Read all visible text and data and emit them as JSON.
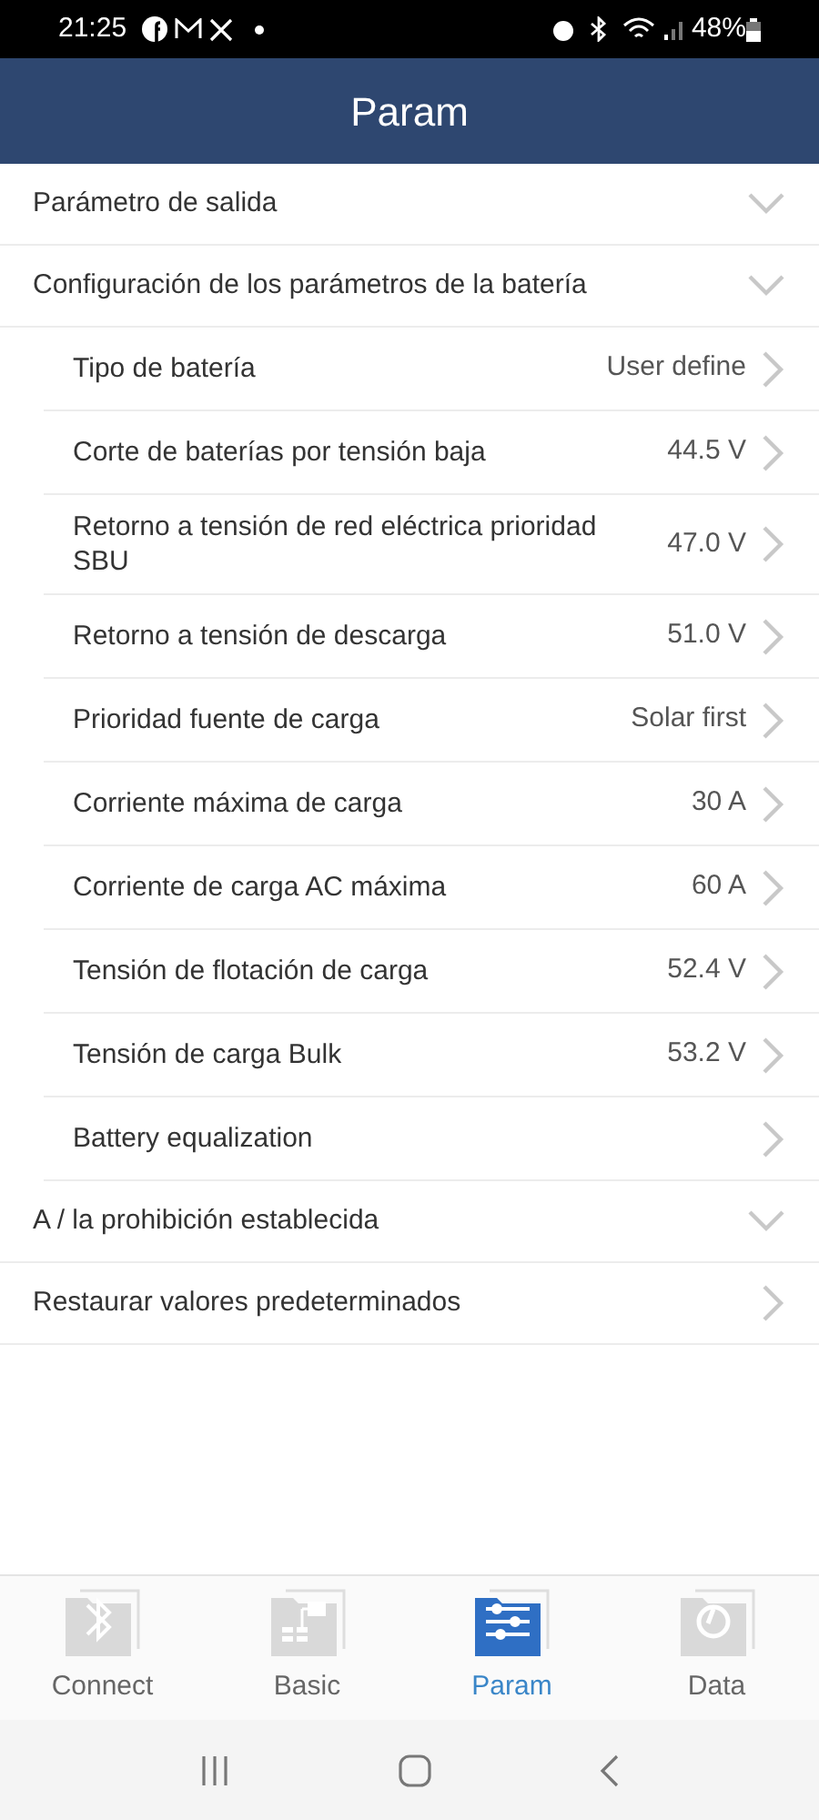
{
  "status_bar": {
    "time": "21:25",
    "battery": "48%"
  },
  "header": {
    "title": "Param"
  },
  "sections": [
    {
      "kind": "group",
      "label": "Parámetro de salida"
    },
    {
      "kind": "group",
      "label": "Configuración de los parámetros de la batería",
      "items": [
        {
          "label": "Tipo de batería",
          "value": "User define"
        },
        {
          "label": "Corte de baterías por tensión baja",
          "value": "44.5 V"
        },
        {
          "label": "Retorno a tensión de red eléctrica prioridad SBU",
          "value": "47.0 V"
        },
        {
          "label": "Retorno a tensión de descarga",
          "value": "51.0 V"
        },
        {
          "label": "Prioridad fuente de carga",
          "value": "Solar first"
        },
        {
          "label": "Corriente máxima de carga",
          "value": "30 A"
        },
        {
          "label": "Corriente de carga AC máxima",
          "value": "60 A"
        },
        {
          "label": "Tensión de flotación de carga",
          "value": "52.4 V"
        },
        {
          "label": "Tensión de carga Bulk",
          "value": "53.2 V"
        },
        {
          "label": "Battery equalization"
        }
      ]
    },
    {
      "kind": "group",
      "label": "A / la prohibición establecida"
    },
    {
      "kind": "link",
      "label": "Restaurar valores predeterminados"
    }
  ],
  "tabs": [
    {
      "kind": "bluetooth",
      "label": "Connect",
      "selected": false
    },
    {
      "kind": "tree",
      "label": "Basic",
      "selected": false
    },
    {
      "kind": "sliders",
      "label": "Param",
      "selected": true
    },
    {
      "kind": "power",
      "label": "Data",
      "selected": false
    }
  ]
}
